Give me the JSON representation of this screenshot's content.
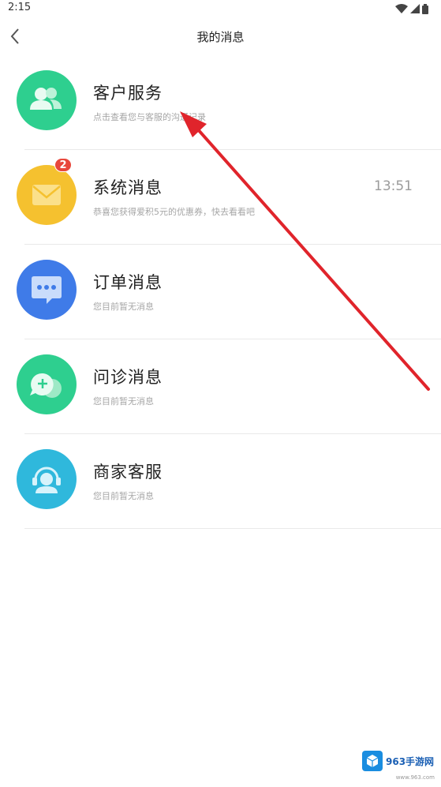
{
  "status_bar": {
    "time": "2:15"
  },
  "nav": {
    "title": "我的消息"
  },
  "items": [
    {
      "name": "客户服务",
      "subtitle": "点击查看您与客服的沟通记录",
      "time": "",
      "badge": "",
      "icon": "customer-service-icon",
      "color": "#2ecf8f"
    },
    {
      "name": "系统消息",
      "subtitle": "恭喜您获得爱积5元的优惠券，快去看看吧",
      "time": "13:51",
      "badge": "2",
      "icon": "mail-icon",
      "color": "#f5c12f"
    },
    {
      "name": "订单消息",
      "subtitle": "您目前暂无消息",
      "time": "",
      "badge": "",
      "icon": "chat-bubble-icon",
      "color": "#3f7be8"
    },
    {
      "name": "问诊消息",
      "subtitle": "您目前暂无消息",
      "time": "",
      "badge": "",
      "icon": "consult-icon",
      "color": "#2ecf8f"
    },
    {
      "name": "商家客服",
      "subtitle": "您目前暂无消息",
      "time": "",
      "badge": "",
      "icon": "merchant-support-icon",
      "color": "#2fb8dc"
    }
  ],
  "watermark": {
    "text": "963手游网",
    "sub": "www.963.com"
  }
}
